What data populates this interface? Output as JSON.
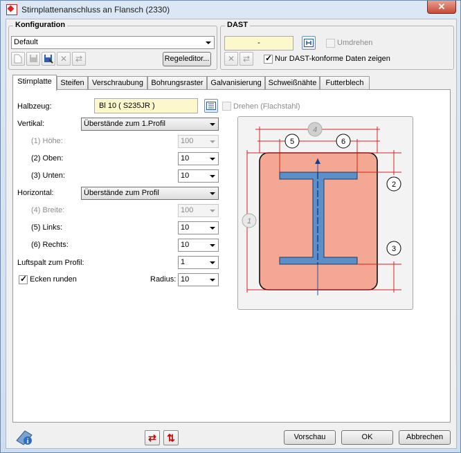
{
  "window": {
    "title": "Stirnplattenanschluss an Flansch (2330)",
    "close_label": "✕"
  },
  "konfiguration": {
    "group_title": "Konfiguration",
    "selected": "Default",
    "regeleditor_label": "Regeleditor..."
  },
  "dast": {
    "group_title": "DAST",
    "value": "-",
    "umdrehen_label": "Umdrehen",
    "umdrehen_checked": false,
    "nur_dast_label": "Nur DAST-konforme Daten zeigen",
    "nur_dast_checked": true
  },
  "tabs": [
    "Stirnplatte",
    "Steifen",
    "Verschraubung",
    "Bohrungsraster",
    "Galvanisierung",
    "Schweißnähte",
    "Futterblech"
  ],
  "active_tab": "Stirnplatte",
  "stirnplatte": {
    "halbzeug_label": "Halbzeug:",
    "halbzeug_value": "Bl 10  ( S235JR )",
    "drehen_label": "Drehen (Flachstahl)",
    "vertikal_label": "Vertikal:",
    "vertikal_value": "Überstände zum 1.Profil",
    "hoehe_label": "(1) Höhe:",
    "hoehe_value": "100",
    "oben_label": "(2) Oben:",
    "oben_value": "10",
    "unten_label": "(3) Unten:",
    "unten_value": "10",
    "horizontal_label": "Horizontal:",
    "horizontal_value": "Überstände zum Profil",
    "breite_label": "(4) Breite:",
    "breite_value": "100",
    "links_label": "(5) Links:",
    "links_value": "10",
    "rechts_label": "(6) Rechts:",
    "rechts_value": "10",
    "luftspalt_label": "Luftspalt zum Profil:",
    "luftspalt_value": "1",
    "ecken_label": "Ecken runden",
    "ecken_checked": true,
    "radius_label": "Radius:",
    "radius_value": "10"
  },
  "diagram": {
    "callouts": [
      "1",
      "2",
      "3",
      "4",
      "5",
      "6"
    ],
    "plate_color": "#f4a793",
    "profile_color": "#5b8fc7",
    "dimension_color": "#d42020"
  },
  "buttons": {
    "vorschau": "Vorschau",
    "ok": "OK",
    "abbrechen": "Abbrechen"
  }
}
